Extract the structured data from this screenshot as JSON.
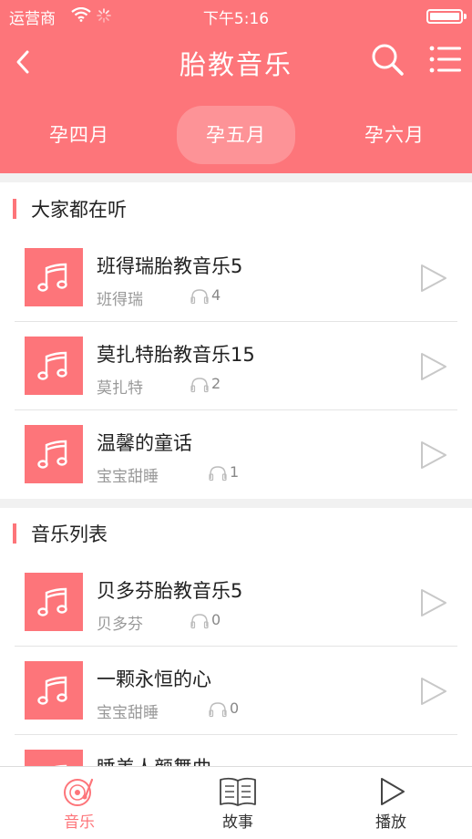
{
  "status_bar": {
    "carrier": "运营商",
    "time": "下午5:16"
  },
  "nav": {
    "title": "胎教音乐"
  },
  "tabs": [
    {
      "label": "孕四月",
      "active": false
    },
    {
      "label": "孕五月",
      "active": true
    },
    {
      "label": "孕六月",
      "active": false
    }
  ],
  "popular": {
    "title": "大家都在听",
    "items": [
      {
        "title": "班得瑞胎教音乐5",
        "artist": "班得瑞",
        "listens": "4"
      },
      {
        "title": "莫扎特胎教音乐15",
        "artist": "莫扎特",
        "listens": "2"
      },
      {
        "title": "温馨的童话",
        "artist": "宝宝甜睡",
        "listens": "1"
      }
    ]
  },
  "music_list": {
    "title": "音乐列表",
    "items": [
      {
        "title": "贝多芬胎教音乐5",
        "artist": "贝多芬",
        "listens": "0"
      },
      {
        "title": "一颗永恒的心",
        "artist": "宝宝甜睡",
        "listens": "0"
      },
      {
        "title": "睡美人颜舞曲",
        "artist": "",
        "listens": ""
      }
    ]
  },
  "tab_bar": [
    {
      "label": "音乐",
      "icon": "music-disc-icon",
      "active": true
    },
    {
      "label": "故事",
      "icon": "book-icon",
      "active": false
    },
    {
      "label": "播放",
      "icon": "play-icon",
      "active": false
    }
  ],
  "colors": {
    "accent": "#fd757a",
    "divider": "#f1f1f1"
  }
}
